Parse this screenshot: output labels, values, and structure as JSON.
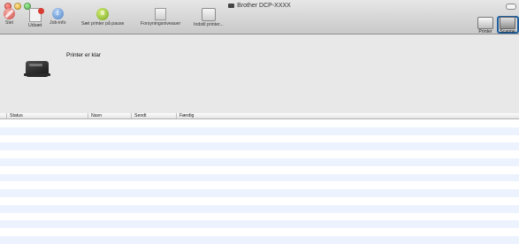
{
  "window": {
    "title": "Brother DCP-XXXX"
  },
  "toolbar": {
    "delete_label": "Slet",
    "hold_label": "Udsæt",
    "info_label": "Job-info",
    "pause_label": "Sæt printer på pause",
    "supply_label": "Forsyningsniveauer",
    "setup_label": "Indstil printer...",
    "printer_label": "Printer",
    "scanner_label": "Scanne"
  },
  "status": {
    "message": "Printer er klar"
  },
  "table": {
    "columns": [
      "Status",
      "Navn",
      "Sendt",
      "Færdig"
    ]
  },
  "colors": {
    "highlight_blue": "#1f5fa0",
    "stripe": "#edf3fe"
  }
}
